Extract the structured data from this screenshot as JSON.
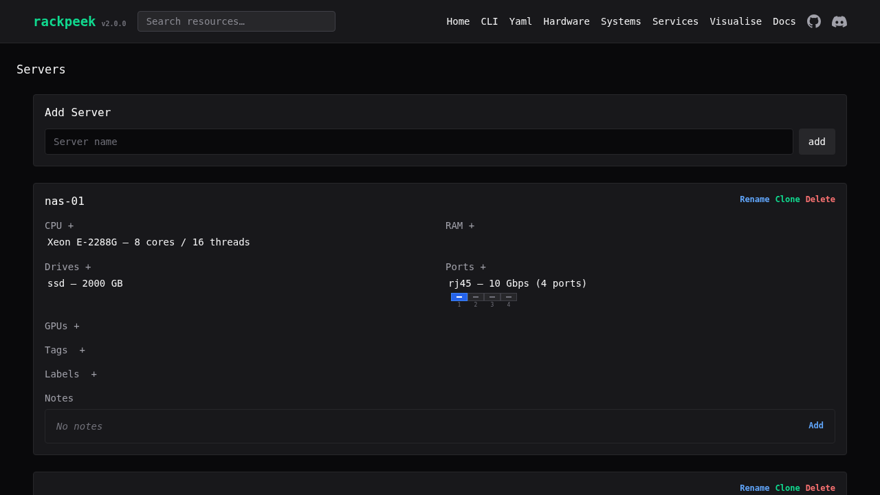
{
  "header": {
    "logo": "rackpeek",
    "version": "v2.0.0",
    "search": {
      "placeholder": "Search resources…"
    },
    "nav": [
      "Home",
      "CLI",
      "Yaml",
      "Hardware",
      "Systems",
      "Services",
      "Visualise",
      "Docs"
    ]
  },
  "page_title": "Servers",
  "add_server": {
    "title": "Add Server",
    "placeholder": "Server name",
    "button": "add"
  },
  "servers": [
    {
      "name": "nas-01",
      "actions": [
        {
          "label": "Rename",
          "kind": "rename"
        },
        {
          "label": "Clone",
          "kind": "clone"
        },
        {
          "label": "Delete",
          "kind": "delete"
        }
      ],
      "sections": [
        {
          "label": "CPU +",
          "items": [
            "Xeon E-2288G — 8 cores / 16 threads"
          ]
        },
        {
          "label": "RAM +"
        },
        {
          "label": "Drives +",
          "items": [
            "ssd — 2000 GB"
          ]
        },
        {
          "label": "Ports +",
          "items": [
            "rj45 — 10 Gbps (4 ports)"
          ],
          "ports": [
            {
              "number": "1",
              "active": true
            },
            {
              "number": "2",
              "active": false
            },
            {
              "number": "3",
              "active": false
            },
            {
              "number": "4",
              "active": false
            }
          ]
        }
      ],
      "extras": [
        "GPUs +",
        "Tags  +",
        "Labels  +"
      ],
      "notes": {
        "label": "Notes",
        "text": "No notes",
        "action": "Add"
      }
    },
    {
      "actions": [
        {
          "label": "Rename",
          "kind": "rename"
        },
        {
          "label": "Clone",
          "kind": "clone"
        },
        {
          "label": "Delete",
          "kind": "delete"
        }
      ]
    }
  ]
}
